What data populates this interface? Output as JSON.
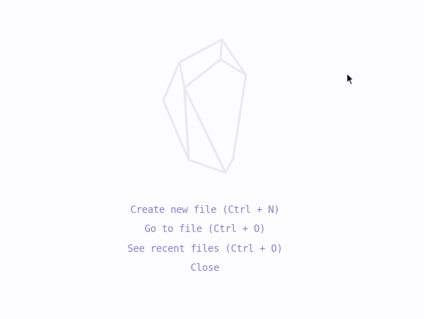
{
  "empty_state": {
    "logo_icon": "crystal-gem-icon",
    "actions": [
      {
        "label": "Create new file (Ctrl + N)"
      },
      {
        "label": "Go to file (Ctrl + O)"
      },
      {
        "label": "See recent files (Ctrl + O)"
      },
      {
        "label": "Close"
      }
    ]
  },
  "colors": {
    "background": "#fdfcfe",
    "logo_stroke": "#ebe9ec",
    "action_text": "#8a7fd6"
  },
  "cursor_icon": "mouse-pointer-icon"
}
